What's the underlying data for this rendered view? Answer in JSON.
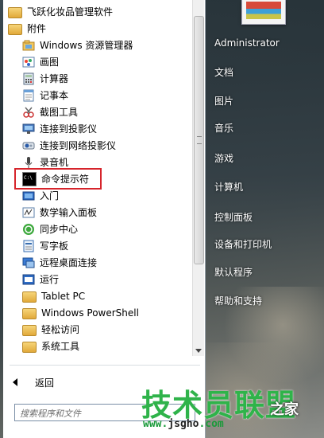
{
  "programs": {
    "items": [
      {
        "label": "飞跃化妆品管理软件",
        "icon": "folder-icon",
        "type": "folder"
      },
      {
        "label": "附件",
        "icon": "folder-icon",
        "type": "folder"
      },
      {
        "label": "Windows 资源管理器",
        "icon": "explorer-icon",
        "type": "app"
      },
      {
        "label": "画图",
        "icon": "paint-icon",
        "type": "app"
      },
      {
        "label": "计算器",
        "icon": "calculator-icon",
        "type": "app"
      },
      {
        "label": "记事本",
        "icon": "notepad-icon",
        "type": "app"
      },
      {
        "label": "截图工具",
        "icon": "snipping-tool-icon",
        "type": "app"
      },
      {
        "label": "连接到投影仪",
        "icon": "projector-icon",
        "type": "app"
      },
      {
        "label": "连接到网络投影仪",
        "icon": "network-projector-icon",
        "type": "app"
      },
      {
        "label": "录音机",
        "icon": "microphone-icon",
        "type": "app"
      },
      {
        "label": "命令提示符",
        "icon": "command-prompt-icon",
        "type": "app"
      },
      {
        "label": "入门",
        "icon": "getting-started-icon",
        "type": "app"
      },
      {
        "label": "数学输入面板",
        "icon": "math-panel-icon",
        "type": "app"
      },
      {
        "label": "同步中心",
        "icon": "sync-center-icon",
        "type": "app"
      },
      {
        "label": "写字板",
        "icon": "wordpad-icon",
        "type": "app"
      },
      {
        "label": "远程桌面连接",
        "icon": "remote-desktop-icon",
        "type": "app"
      },
      {
        "label": "运行",
        "icon": "run-icon",
        "type": "app"
      },
      {
        "label": "Tablet PC",
        "icon": "folder-icon",
        "type": "folder"
      },
      {
        "label": "Windows PowerShell",
        "icon": "folder-icon",
        "type": "folder"
      },
      {
        "label": "轻松访问",
        "icon": "folder-icon",
        "type": "folder"
      },
      {
        "label": "系统工具",
        "icon": "folder-icon",
        "type": "folder"
      }
    ],
    "highlighted": "命令提示符"
  },
  "back_label": "返回",
  "search": {
    "placeholder": "搜索程序和文件"
  },
  "right_menu": {
    "items": [
      "Administrator",
      "文档",
      "图片",
      "音乐",
      "游戏",
      "计算机",
      "控制面板",
      "设备和打印机",
      "默认程序",
      "帮助和支持"
    ]
  },
  "watermark": {
    "main": "技术员联盟",
    "side": "之家",
    "url_prefix": "www.",
    "url_brand": "jsgho",
    "url_suffix": ".com"
  },
  "colors": {
    "highlight": "#d6242b",
    "watermark": "#2fb34a"
  }
}
